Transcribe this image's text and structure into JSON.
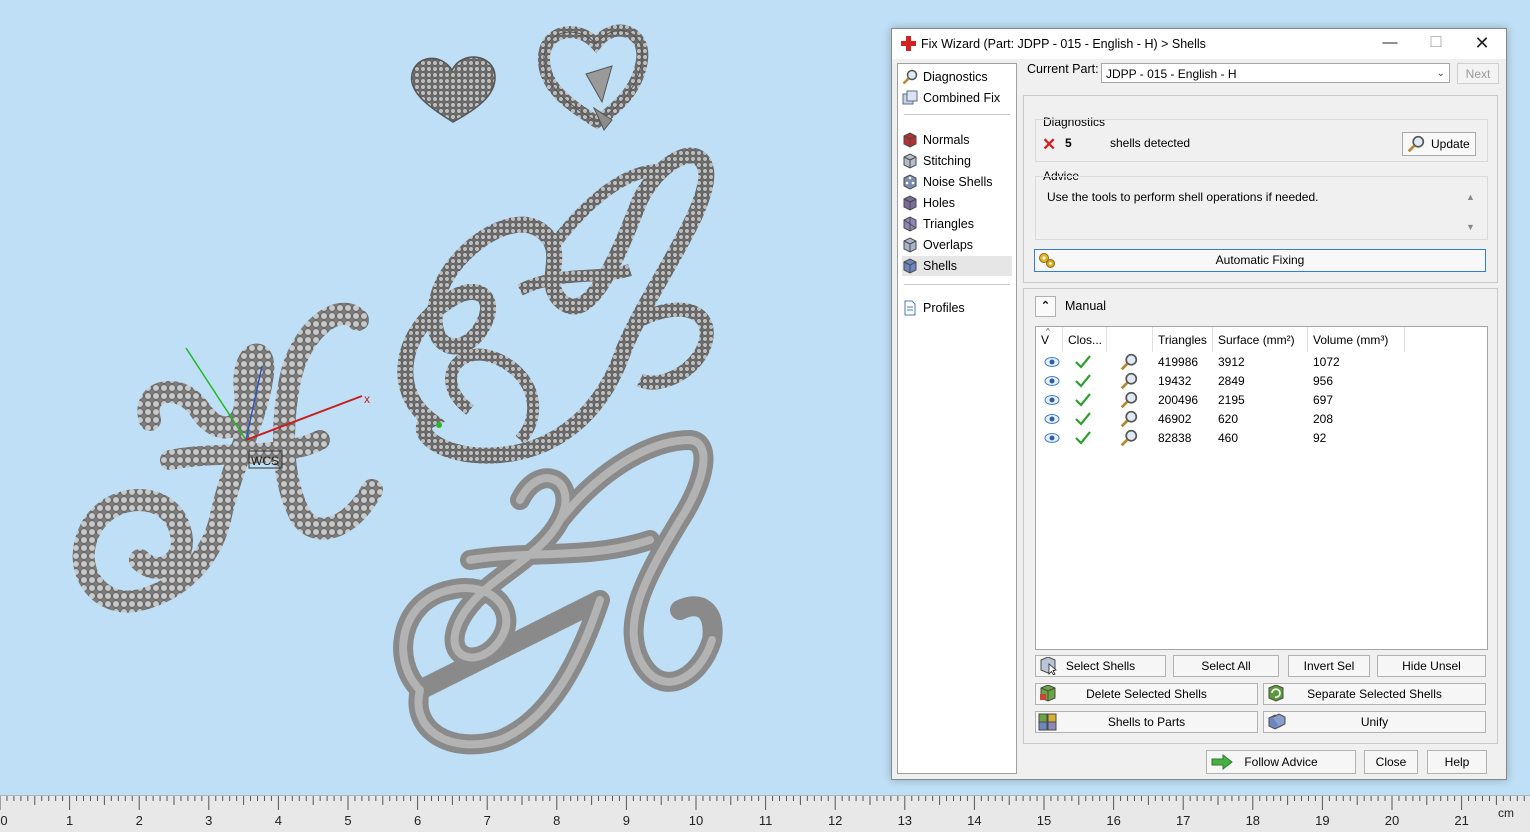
{
  "window": {
    "title": "Fix Wizard (Part: JDPP - 015 - English - H) > Shells",
    "min_glyph": "—",
    "max_glyph": "☐",
    "close_glyph": "✕"
  },
  "nav": {
    "items": [
      {
        "label": "Diagnostics",
        "icon": "diagnostics-magnifier-icon"
      },
      {
        "label": "Combined Fix",
        "icon": "combined-fix-icon"
      },
      {
        "label": "Normals",
        "icon": "normals-cube-icon"
      },
      {
        "label": "Stitching",
        "icon": "stitching-cube-icon"
      },
      {
        "label": "Noise Shells",
        "icon": "noise-shells-cube-icon"
      },
      {
        "label": "Holes",
        "icon": "holes-cube-icon"
      },
      {
        "label": "Triangles",
        "icon": "triangles-cube-icon"
      },
      {
        "label": "Overlaps",
        "icon": "overlaps-cube-icon"
      },
      {
        "label": "Shells",
        "icon": "shells-cube-icon",
        "active": true
      },
      {
        "label": "Profiles",
        "icon": "profiles-document-icon"
      }
    ]
  },
  "current_part": {
    "label": "Current Part:",
    "value": "JDPP - 015 - English - H",
    "next_label": "Next"
  },
  "diagnostics": {
    "title": "Diagnostics",
    "count": "5",
    "text": "shells detected",
    "update_label": "Update",
    "status_color": "#d42020"
  },
  "advice": {
    "title": "Advice",
    "text": "Use the tools to perform shell operations if needed."
  },
  "automatic_fixing_label": "Automatic Fixing",
  "manual": {
    "label": "Manual",
    "collapse_glyph": "⌃",
    "columns": [
      "V",
      "Clos...",
      "",
      "Triangles",
      "Surface (mm²)",
      "Volume (mm³)"
    ],
    "rows": [
      {
        "triangles": "419986",
        "surface": "3912",
        "volume": "1072"
      },
      {
        "triangles": "19432",
        "surface": "2849",
        "volume": "956"
      },
      {
        "triangles": "200496",
        "surface": "2195",
        "volume": "697"
      },
      {
        "triangles": "46902",
        "surface": "620",
        "volume": "208"
      },
      {
        "triangles": "82838",
        "surface": "460",
        "volume": "92"
      }
    ]
  },
  "buttons": {
    "select_shells": "Select Shells",
    "select_all": "Select All",
    "invert_sel": "Invert Sel",
    "hide_unsel": "Hide Unsel",
    "delete_selected": "Delete Selected Shells",
    "separate_selected": "Separate Selected Shells",
    "shells_to_parts": "Shells to Parts",
    "unify": "Unify",
    "follow_advice": "Follow Advice",
    "close": "Close",
    "help": "Help"
  },
  "viewport": {
    "axis_x_label": "x",
    "wcs_label": "WCS",
    "background": "#bedff6"
  },
  "ruler": {
    "unit": "cm",
    "labels": [
      "0",
      "1",
      "2",
      "3",
      "4",
      "5",
      "6",
      "7",
      "8",
      "9",
      "10",
      "11",
      "12",
      "13",
      "14",
      "15",
      "16",
      "17",
      "18",
      "19",
      "20",
      "21"
    ]
  }
}
